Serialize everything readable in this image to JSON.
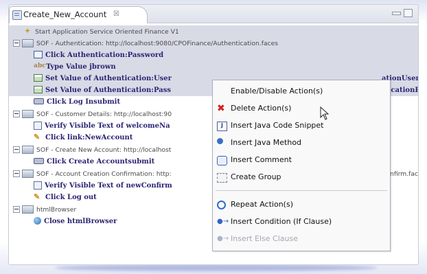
{
  "editor": {
    "tab_title": "Create_New_Account",
    "tab_close_glyph": "☒"
  },
  "tree": {
    "rows": [
      {
        "icon": "start-icon",
        "label": "Start  Application  Service Oriented Finance V1",
        "style": "plain"
      },
      {
        "icon": "group-icon",
        "label": "SOF - Authentication: http://localhost:9080/CPOFinance/Authentication.faces",
        "style": "plain",
        "expanded": true
      },
      {
        "icon": "click-icon",
        "label": "Click  Authentication:Password",
        "style": "action"
      },
      {
        "icon": "type-icon",
        "label": "Type  Value  jbrown",
        "style": "action"
      },
      {
        "icon": "set-value-icon",
        "label": "Set  Value  of  Authentication:User",
        "style": "action"
      },
      {
        "icon": "set-value-icon",
        "label": "Set  Value  of  Authentication:Pass",
        "style": "action"
      },
      {
        "icon": "submit-icon",
        "label": "Click  Log  Insubmit",
        "style": "action"
      },
      {
        "icon": "group-icon",
        "label": "SOF - Customer Details: http://localhost:90",
        "style": "plain",
        "expanded": true
      },
      {
        "icon": "verify-icon",
        "label": "Verify  Visible  Text  of  welcomeNa",
        "style": "action"
      },
      {
        "icon": "link-icon",
        "label": "Click  link:NewAccount",
        "style": "action"
      },
      {
        "icon": "group-icon",
        "label": "SOF - Create New Account: http://localhost",
        "style": "plain",
        "expanded": true
      },
      {
        "icon": "submit-icon",
        "label": "Click  Create  Accountsubmit",
        "style": "action"
      },
      {
        "icon": "group-icon",
        "label": "SOF - Account Creation Confirmation: http:",
        "style": "plain",
        "expanded": true
      },
      {
        "icon": "verify-icon",
        "label": "Verify  Visible  Text  of  newConfirm",
        "style": "action"
      },
      {
        "icon": "link-icon",
        "label": "Click  Log  out",
        "style": "action"
      },
      {
        "icon": "group-icon",
        "label": "htmlBrowser",
        "style": "plain",
        "expanded": true
      },
      {
        "icon": "globe-icon",
        "label": "Close  htmlBrowser",
        "style": "action"
      }
    ],
    "overflow_right": {
      "row4": "ationUser",
      "row5": "ticationP",
      "row12": "Confirm.face"
    }
  },
  "context_menu": {
    "items": [
      {
        "label": "Enable/Disable Action(s)",
        "icon": "",
        "enabled": true
      },
      {
        "label": "Delete Action(s)",
        "icon": "delete-icon",
        "enabled": true
      },
      {
        "label": "Insert Java Code Snippet",
        "icon": "java-snippet-icon",
        "enabled": true
      },
      {
        "label": "Insert Java Method",
        "icon": "java-method-icon",
        "enabled": true
      },
      {
        "label": "Insert Comment",
        "icon": "comment-icon",
        "enabled": true
      },
      {
        "label": "Create Group",
        "icon": "group-icon",
        "enabled": true
      },
      {
        "label": "Repeat Action(s)",
        "icon": "repeat-icon",
        "enabled": true
      },
      {
        "label": "Insert Condition (If Clause)",
        "icon": "condition-icon",
        "enabled": true
      },
      {
        "label": "Insert Else Clause",
        "icon": "else-clause-icon",
        "enabled": false
      }
    ]
  }
}
